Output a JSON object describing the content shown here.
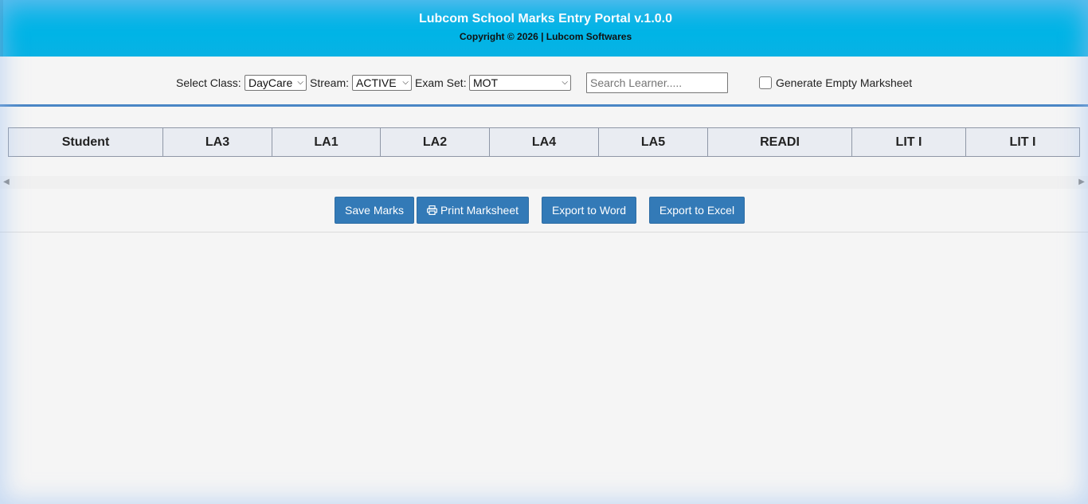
{
  "header": {
    "title": "Lubcom School Marks Entry Portal v.1.0.0",
    "copyright": "Copyright © 2026 | Lubcom Softwares"
  },
  "controls": {
    "class_label": "Select Class:",
    "class_value": "DayCare",
    "stream_label": "Stream:",
    "stream_value": "ACTIVE",
    "exam_label": "Exam Set:",
    "exam_value": "MOT",
    "search_placeholder": "Search Learner.....",
    "empty_marksheet_label": "Generate Empty Marksheet",
    "empty_marksheet_checked": false
  },
  "table": {
    "columns": [
      "Student",
      "LA3",
      "LA1",
      "LA2",
      "LA4",
      "LA5",
      "READI",
      "LIT I",
      "LIT I"
    ]
  },
  "buttons": {
    "save": "Save Marks",
    "print": "Print Marksheet",
    "word": "Export to Word",
    "excel": "Export to Excel"
  },
  "colors": {
    "header": "#00b4e6",
    "accent": "#337ab7",
    "divider": "#4a86c5"
  }
}
